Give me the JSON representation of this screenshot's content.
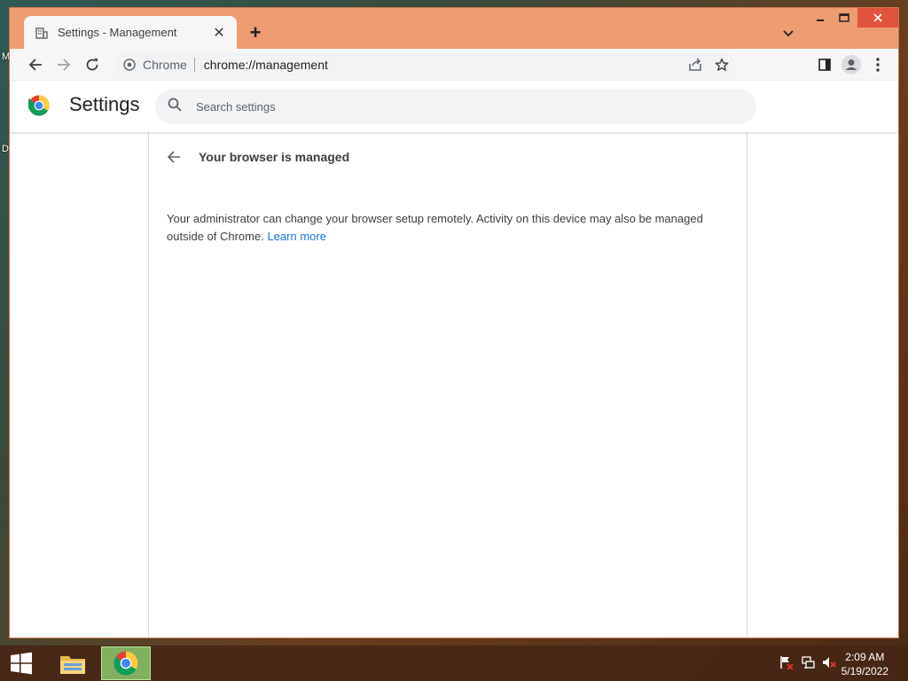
{
  "desktop": {
    "label_top": "M",
    "label_mid": "D"
  },
  "browser": {
    "tab": {
      "title": "Settings - Management",
      "close_glyph": "✕"
    },
    "new_tab_glyph": "+",
    "omnibox": {
      "chip_label": "Chrome",
      "url": "chrome://management"
    }
  },
  "settings": {
    "title": "Settings",
    "search_placeholder": "Search settings"
  },
  "management": {
    "heading": "Your browser is managed",
    "description": "Your administrator can change your browser setup remotely. Activity on this device may also be managed outside of Chrome.",
    "learn_more": "Learn more"
  },
  "taskbar": {
    "time": "2:09 AM",
    "date": "5/19/2022",
    "apps": [
      "file-explorer",
      "chrome"
    ]
  },
  "colors": {
    "window_frame": "#ee9c72",
    "accent_link": "#1a73e8",
    "close_button": "#e0533d"
  }
}
